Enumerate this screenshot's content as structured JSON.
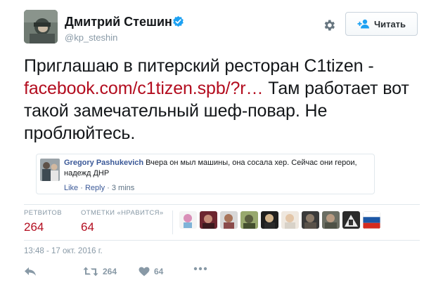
{
  "author": {
    "display_name": "Дмитрий Стешин",
    "screen_name": "@kp_steshin",
    "verified": true
  },
  "follow_button": {
    "label": "Читать",
    "icon": "follow-user-icon"
  },
  "settings_icon": "gear-icon",
  "tweet": {
    "text_before_link": "Приглашаю в питерский ресторан C1tizen - ",
    "link_text": "facebook.com/c1tizen.spb/?r…",
    "text_after_link": "  Там работает вот такой замечательный шеф-повар. Не проблюйтесь."
  },
  "quoted": {
    "author": "Gregory Pashukevich",
    "text": " Вчера он мыл машины, она сосала хер. Сейчас они герои, надежд ДНР",
    "like_label": "Like",
    "separator": " · ",
    "reply_label": "Reply",
    "time": "3 mins"
  },
  "stats": {
    "retweets_label": "РЕТВИТОВ",
    "retweets_count": "264",
    "likes_label": "ОТМЕТКИ «НРАВИТСЯ»",
    "likes_count": "64"
  },
  "timestamp": "13:48 - 17 окт. 2016 г.",
  "actions": {
    "retweet_count": "264",
    "like_count": "64"
  },
  "colors": {
    "link": "#b30d1f",
    "counts": "#b30d1f",
    "muted": "#8899a6",
    "verified": "#1da1f2"
  }
}
